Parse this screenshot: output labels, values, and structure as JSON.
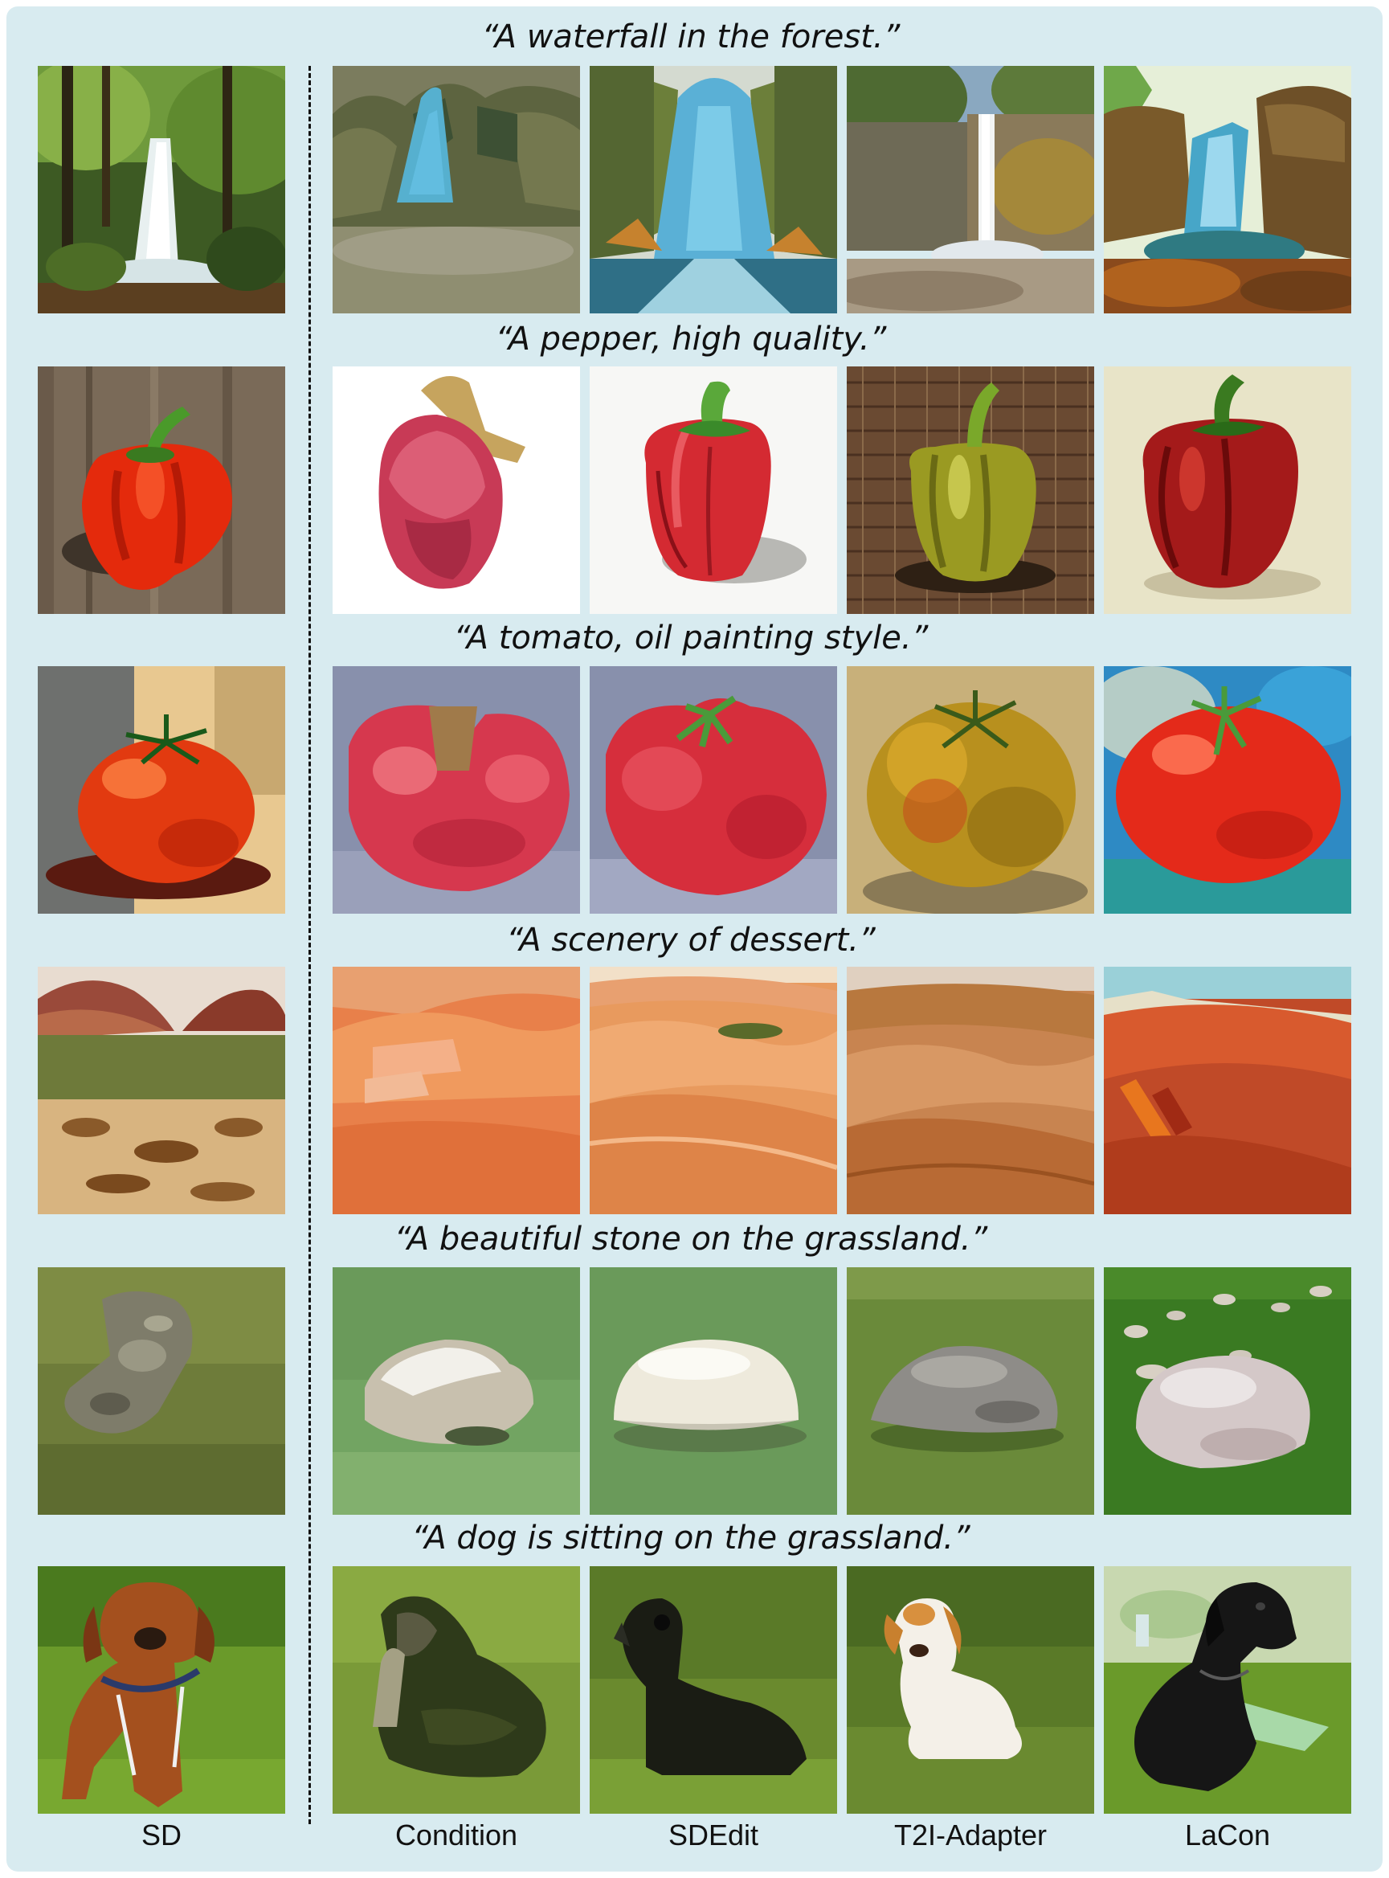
{
  "prompts": [
    "“A waterfall in the forest.”",
    "“A pepper, high quality.”",
    "“A tomato, oil painting style.”",
    "“A scenery of dessert.”",
    "“A beautiful stone on the grassland.”",
    "“A dog is sitting on the grassland.”"
  ],
  "columns": [
    "SD",
    "Condition",
    "SDEdit",
    "T2I-Adapter",
    "LaCon"
  ],
  "colors": {
    "panel_background": "#d8ebf0",
    "text": "#111111"
  }
}
